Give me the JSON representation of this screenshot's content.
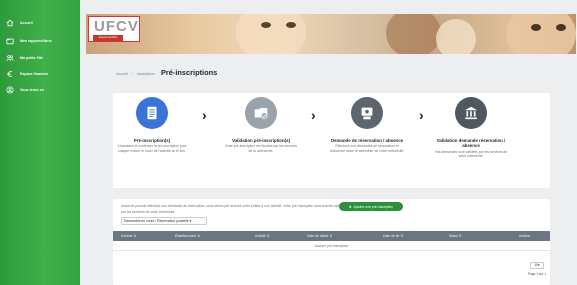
{
  "sidebar": {
    "items": [
      {
        "label": "Accueil",
        "icon": "home-icon"
      },
      {
        "label": "Mes rapports/liens",
        "icon": "folder-icon"
      },
      {
        "label": "Ma petite fille",
        "icon": "people-icon"
      },
      {
        "label": "Espace financier",
        "icon": "euro-icon"
      },
      {
        "label": "Vous tenez en",
        "icon": "user-circle-icon"
      }
    ]
  },
  "banner": {
    "logo_text": "UFCV",
    "logo_sub": "Espace familles"
  },
  "breadcrumb": {
    "home": "Accueil",
    "section": "Inscriptions",
    "title": "Pré-inscriptions"
  },
  "steps": [
    {
      "title": "Pré-inscription(s)",
      "desc": "Choisissez et confirmez la pré-inscription pour chaque enfant, le choix de l'activité ou le lieu.",
      "icon": "document-icon",
      "color": "#3b74d9"
    },
    {
      "title": "Validation pré-inscription(s)",
      "desc": "Votre pré-inscription est étudiée par les services de la collectivité.",
      "icon": "folder-check-icon",
      "color": "#9aa3ac"
    },
    {
      "title": "Demande de réservation / absence",
      "desc": "Effectuez vos demandes de réservation et d'absence selon le calendrier de votre collectivité.",
      "icon": "calendar-person-icon",
      "color": "#5d666e"
    },
    {
      "title": "Validation demande réservation / absence",
      "desc": "Vos demandes sont validées par les services de votre collectivité.",
      "icon": "institution-icon",
      "color": "#4f5860"
    }
  ],
  "table": {
    "intro": "Avant de pouvoir effectuer une demande de réservation, vous devez pré-inscrire votre enfant à une activité. Votre pré-inscription sera ensuite validée par les services de votre collectivité.",
    "new_button": "Ajouter une pré-inscription",
    "filter_value": "Demandes en cours / Réservation possible",
    "columns": [
      "Enfants",
      "Établissement",
      "Activité",
      "Date de début",
      "Date de fin",
      "Statut",
      "Actions"
    ],
    "empty": "Aucune pré-inscription",
    "page_size": "10",
    "page_info": "Page 1 sur 1"
  }
}
